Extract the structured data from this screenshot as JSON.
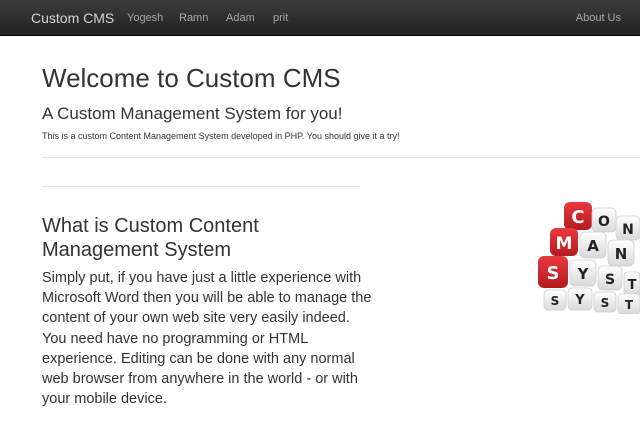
{
  "navbar": {
    "brand": "Custom CMS",
    "links": [
      "Yogesh",
      "Ramn",
      "Adam",
      "prit"
    ],
    "about": "About Us"
  },
  "hero": {
    "title": "Welcome to Custom CMS",
    "subtitle": "A Custom Management System for you!",
    "description": "This is a custom Content Management System developed in PHP. You should give it a try!"
  },
  "section": {
    "heading": "What is Custom Content Management System",
    "body": "Simply put, if you have just a little experience with Microsoft Word then you will be able to manage the content of your own web site very easily indeed. You need have no programming or HTML experience. Editing can be done with any normal web browser from anywhere in the world - or with your mobile device."
  },
  "image": {
    "letters": {
      "cms": [
        "C",
        "M",
        "S"
      ],
      "row1": [
        "O",
        "N"
      ],
      "row2": [
        "A",
        "N"
      ],
      "row3": [
        "Y",
        "S",
        "T"
      ],
      "row4": [
        "S",
        "Y",
        "S",
        "T"
      ]
    },
    "colors": {
      "red": "#d3232a",
      "white": "#f4f4f4"
    }
  }
}
